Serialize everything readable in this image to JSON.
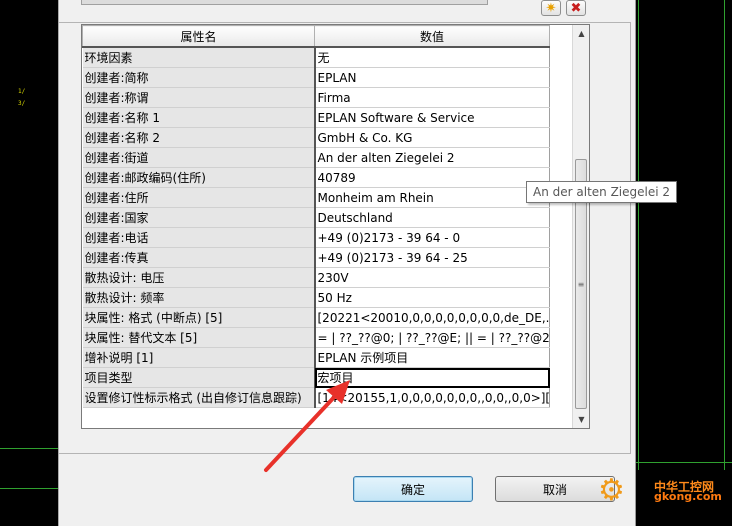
{
  "cad": {
    "left_labels": [
      "1/",
      "3/"
    ]
  },
  "toolbar": {
    "new_icon": "star-new-icon",
    "delete_icon": "red-x-delete-icon",
    "new_glyph": "✷",
    "delete_glyph": "✖"
  },
  "table": {
    "headers": [
      "属性名",
      "数值"
    ],
    "rows": [
      {
        "name": "环境因素",
        "value": "无"
      },
      {
        "name": "创建者:简称",
        "value": "EPLAN"
      },
      {
        "name": "创建者:称谓",
        "value": "Firma"
      },
      {
        "name": "创建者:名称 1",
        "value": "EPLAN Software & Service"
      },
      {
        "name": "创建者:名称 2",
        "value": "GmbH & Co. KG"
      },
      {
        "name": "创建者:街道",
        "value": "An der alten Ziegelei 2"
      },
      {
        "name": "创建者:邮政编码(住所)",
        "value": "40789"
      },
      {
        "name": "创建者:住所",
        "value": "Monheim am Rhein"
      },
      {
        "name": "创建者:国家",
        "value": "Deutschland"
      },
      {
        "name": "创建者:电话",
        "value": "+49 (0)2173 - 39 64 - 0"
      },
      {
        "name": "创建者:传真",
        "value": "+49 (0)2173 - 39 64 - 25"
      },
      {
        "name": "散热设计: 电压",
        "value": "230V"
      },
      {
        "name": "散热设计: 频率",
        "value": "50 Hz"
      },
      {
        "name": "块属性: 格式 (中断点) [5]",
        "value": "[20221<20010,0,0,0,0,0,0,0,0,de_DE,..."
      },
      {
        "name": "块属性: 替代文本 [5]",
        "value": "= | ??_??@0; | ??_??@E; || = | ??_??@2;..."
      },
      {
        "name": "增补说明 [1]",
        "value": "EPLAN 示例项目"
      },
      {
        "name": "项目类型",
        "value": "宏项目"
      },
      {
        "name": "设置修订性标示格式 (出自修订信息跟踪)",
        "value": "[14<20155,1,0,0,0,0,0,0,0,,0,0,,0,0>][..."
      }
    ],
    "selected_row": 16
  },
  "scrollbar": {
    "up_glyph": "▲",
    "down_glyph": "▼",
    "grip_glyph": "≡"
  },
  "tooltip": {
    "text": "An der alten Ziegelei 2"
  },
  "buttons": {
    "ok_label": "确定",
    "cancel_label": "取消"
  },
  "watermark": {
    "chinese": "中华工控网",
    "url": "gkong.com",
    "icon": "gear-icon",
    "glyph": "⚙"
  },
  "colors": {
    "cad_background": "#000000",
    "cad_grid": "#2fa02f",
    "annotation_arrow": "#e8312a",
    "ok_button": "#c4e5f6"
  }
}
